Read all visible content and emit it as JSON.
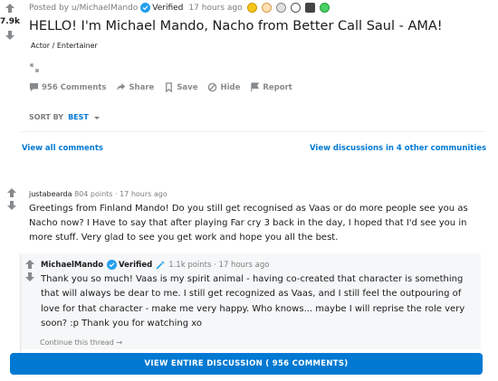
{
  "post": {
    "score": "7.9k",
    "posted_by": "Posted by u/MichaelMando",
    "verified_label": "Verified",
    "time": "17 hours ago",
    "title": "HELLO! I'm Michael Mando, Nacho from Better Call Saul - AMA!",
    "flair": "Actor / Entertainer",
    "awards": [
      "award-icon-gold",
      "award-icon-face",
      "award-icon-star",
      "award-icon-coin",
      "award-icon-box",
      "award-icon-green"
    ]
  },
  "actions": {
    "comments": "956 Comments",
    "share": "Share",
    "save": "Save",
    "hide": "Hide",
    "report": "Report"
  },
  "sort": {
    "label": "SORT BY",
    "value": "BEST"
  },
  "links": {
    "view_all": "View all comments",
    "view_other": "View discussions in 4 other communities"
  },
  "comment1": {
    "author": "justabearda",
    "meta": "804 points · 17 hours ago",
    "body": "Greetings from Finland Mando! Do you still get recognised as Vaas or do more people see you as Nacho now? I Have to say that after playing Far cry 3 back in the day, I hoped that I'd see you in more stuff. Very glad to see you get work and hope you all the best."
  },
  "comment2": {
    "author": "MichaelMando",
    "verified_label": "Verified",
    "meta": "1.1k points · 17 hours ago",
    "body": "Thank you so much! Vaas is my spirit animal - having co-created that character is something that will always be dear to me. I still get recognized as Vaas, and I still feel the outpouring of love for that character - make me very happy. Who knows... maybe I will reprise the role very soon? :p Thank you for watching xo",
    "continue": "Continue this thread →"
  },
  "cta": {
    "label": "VIEW ENTIRE DISCUSSION ( 956 COMMENTS)"
  },
  "colors": {
    "accent": "#0079d3",
    "verified": "#24a0ed",
    "muted": "#878a8c"
  }
}
